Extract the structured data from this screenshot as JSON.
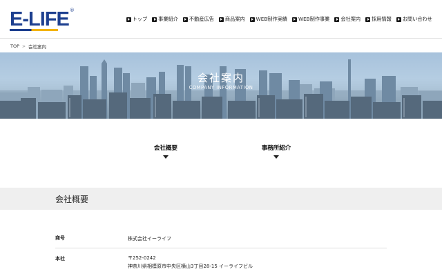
{
  "header": {
    "logo": "E-LIFE",
    "logo_reg": "®",
    "nav": [
      {
        "label": "トップ"
      },
      {
        "label": "事業紹介"
      },
      {
        "label": "不動産広告"
      },
      {
        "label": "商品案内"
      },
      {
        "label": "WEB制作実績"
      },
      {
        "label": "WEB制作事業"
      },
      {
        "label": "会社案内"
      },
      {
        "label": "採用情報"
      },
      {
        "label": "お問い合わせ"
      }
    ]
  },
  "breadcrumb": {
    "home": "TOP",
    "separator": ">",
    "current": "会社案内"
  },
  "hero": {
    "title": "会社案内",
    "subtitle": "COMPANY INFORMATION"
  },
  "anchors": [
    {
      "label": "会社概要"
    },
    {
      "label": "事務所紹介"
    }
  ],
  "section": {
    "title": "会社概要"
  },
  "info": {
    "rows": [
      {
        "label": "商号",
        "lines": [
          "株式会社イーライフ"
        ]
      },
      {
        "label": "本社",
        "lines": [
          "〒252-0242",
          "神奈川県相模原市中央区横山3丁目28-15 イーライフビル"
        ]
      }
    ]
  },
  "colors": {
    "brand_blue": "#1d3f8f",
    "brand_yellow": "#f3b400",
    "band_bg": "#efefef"
  }
}
